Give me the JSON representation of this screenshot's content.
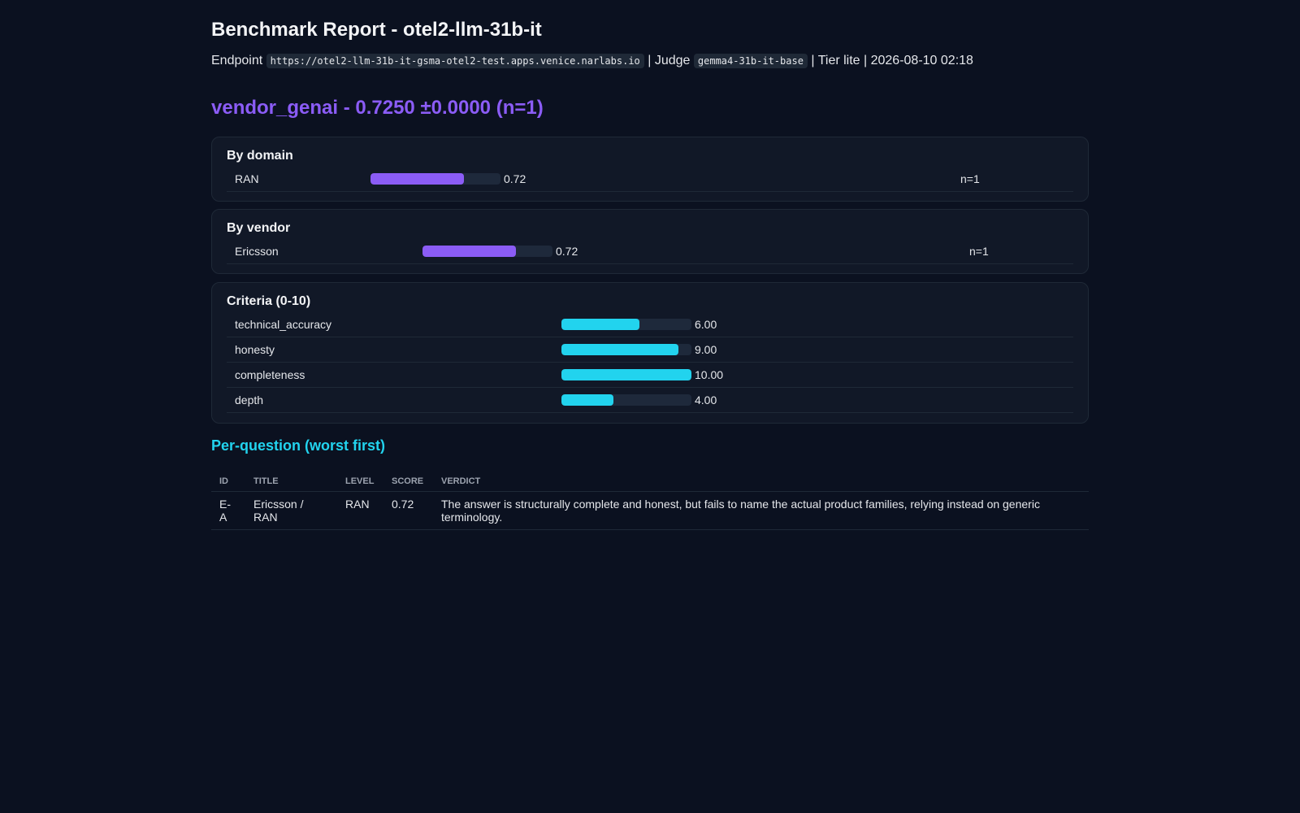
{
  "header": {
    "title": "Benchmark Report - otel2-llm-31b-it",
    "endpoint_label": "Endpoint",
    "endpoint_url": "https://otel2-llm-31b-it-gsma-otel2-test.apps.venice.narlabs.io",
    "judge_label": "| Judge",
    "judge_model": "gemma4-31b-it-base",
    "tail": "| Tier lite | 2026-08-10 02:18"
  },
  "suite": {
    "heading": "vendor_genai - 0.7250 ±0.0000 (n=1)"
  },
  "by_domain": {
    "title": "By domain",
    "rows": [
      {
        "label": "RAN",
        "value": "0.72",
        "fraction": 0.72,
        "n": "n=1"
      }
    ]
  },
  "by_vendor": {
    "title": "By vendor",
    "rows": [
      {
        "label": "Ericsson",
        "value": "0.72",
        "fraction": 0.72,
        "n": "n=1"
      }
    ]
  },
  "criteria": {
    "title": "Criteria (0-10)",
    "rows": [
      {
        "label": "technical_accuracy",
        "value": "6.00",
        "fraction": 0.6
      },
      {
        "label": "honesty",
        "value": "9.00",
        "fraction": 0.9
      },
      {
        "label": "completeness",
        "value": "10.00",
        "fraction": 1.0
      },
      {
        "label": "depth",
        "value": "4.00",
        "fraction": 0.4
      }
    ]
  },
  "per_question": {
    "title": "Per-question (worst first)",
    "columns": [
      "ID",
      "TITLE",
      "LEVEL",
      "SCORE",
      "VERDICT"
    ],
    "rows": [
      {
        "id": "E-A",
        "title": "Ericsson / RAN",
        "level": "RAN",
        "score": "0.72",
        "verdict": "The answer is structurally complete and honest, but fails to name the actual product families, relying instead on generic terminology."
      }
    ]
  }
}
